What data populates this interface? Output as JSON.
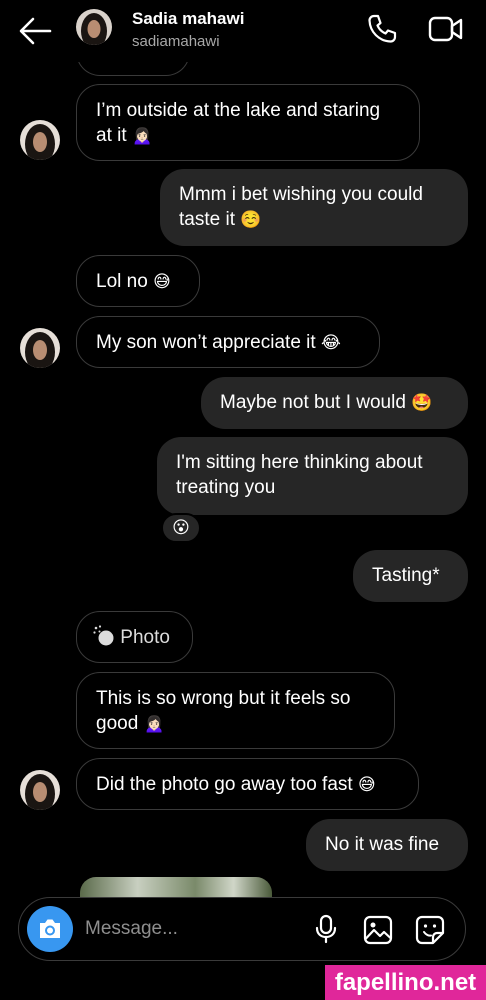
{
  "header": {
    "name": "Sadia mahawi",
    "username": "sadiamahawi"
  },
  "messages": [
    {
      "side": "in",
      "text": "I’m outside at the lake and staring at it",
      "emoji": "🙍🏻‍♀️"
    },
    {
      "side": "out",
      "text": "Mmm i bet wishing you could taste it",
      "emoji": "☺️"
    },
    {
      "side": "in",
      "text": "Lol no",
      "emoji": "😅"
    },
    {
      "side": "in",
      "text": "My son won’t appreciate it",
      "emoji": "😂"
    },
    {
      "side": "out",
      "text": "Maybe not but I would",
      "emoji": "🤩"
    },
    {
      "side": "out",
      "text": "I'm sitting here thinking about treating you",
      "reaction": "😮"
    },
    {
      "side": "out",
      "text": "Tasting*"
    },
    {
      "side": "in",
      "text": "Photo",
      "type": "expired-photo"
    },
    {
      "side": "in",
      "text": "This is so wrong but it feels so good",
      "emoji": "🙍🏻‍♀️"
    },
    {
      "side": "in",
      "text": "Did the photo go away too fast",
      "emoji": "😅"
    },
    {
      "side": "out",
      "text": "No it was fine"
    }
  ],
  "composer": {
    "placeholder": "Message..."
  },
  "icons": [
    "back-arrow-icon",
    "phone-icon",
    "video-camera-icon",
    "camera-icon",
    "microphone-icon",
    "gallery-icon",
    "sticker-icon"
  ],
  "colors": {
    "background": "#000000",
    "outgoing_bubble": "#262626",
    "incoming_border": "#3a3a3a",
    "camera_button": "#3897f0",
    "secondary_text": "#a8a8a8"
  },
  "watermark": "fapellino.net"
}
